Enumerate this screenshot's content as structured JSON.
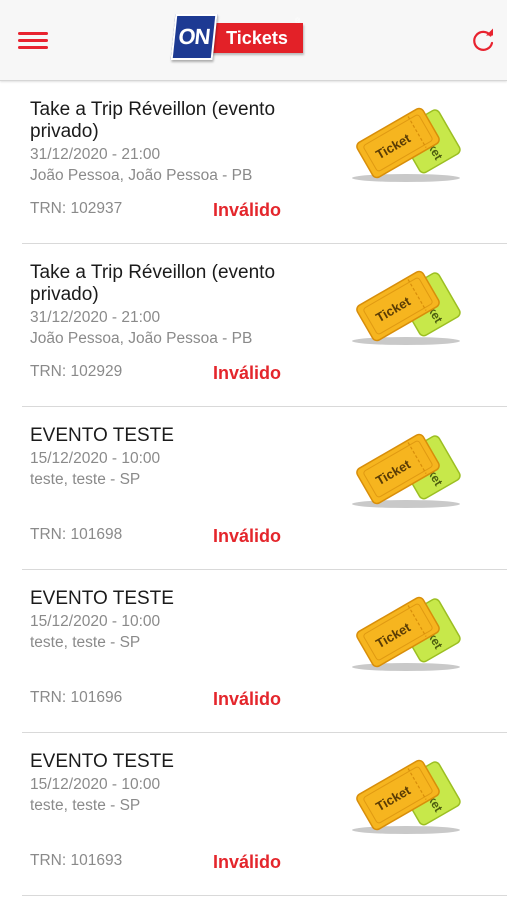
{
  "header": {
    "logo": {
      "on": "ON",
      "tickets": "Tickets",
      "reg": "®"
    }
  },
  "icons": {
    "menu": "hamburger-menu-icon",
    "refresh": "refresh-icon",
    "ticket": "ticket-icon"
  },
  "colors": {
    "accent": "#e8232f",
    "status_invalid": "#e4262c",
    "logo_blue": "#1d3a93",
    "logo_red": "#e32128"
  },
  "tickets": [
    {
      "title_line1": "Take a Trip Réveillon (evento",
      "title_line2": "privado)",
      "datetime": "31/12/2020 - 21:00",
      "location": "João Pessoa, João Pessoa - PB",
      "trn": "TRN: 102937",
      "status": "Inválido"
    },
    {
      "title_line1": "Take a Trip Réveillon (evento",
      "title_line2": "privado)",
      "datetime": "31/12/2020 - 21:00",
      "location": "João Pessoa, João Pessoa - PB",
      "trn": "TRN: 102929",
      "status": "Inválido"
    },
    {
      "title_line1": "EVENTO TESTE",
      "title_line2": "",
      "datetime": "15/12/2020 - 10:00",
      "location": "teste, teste - SP",
      "trn": "TRN: 101698",
      "status": "Inválido"
    },
    {
      "title_line1": "EVENTO TESTE",
      "title_line2": "",
      "datetime": "15/12/2020 - 10:00",
      "location": "teste, teste - SP",
      "trn": "TRN: 101696",
      "status": "Inválido"
    },
    {
      "title_line1": "EVENTO TESTE",
      "title_line2": "",
      "datetime": "15/12/2020 - 10:00",
      "location": "teste, teste - SP",
      "trn": "TRN: 101693",
      "status": "Inválido"
    }
  ]
}
